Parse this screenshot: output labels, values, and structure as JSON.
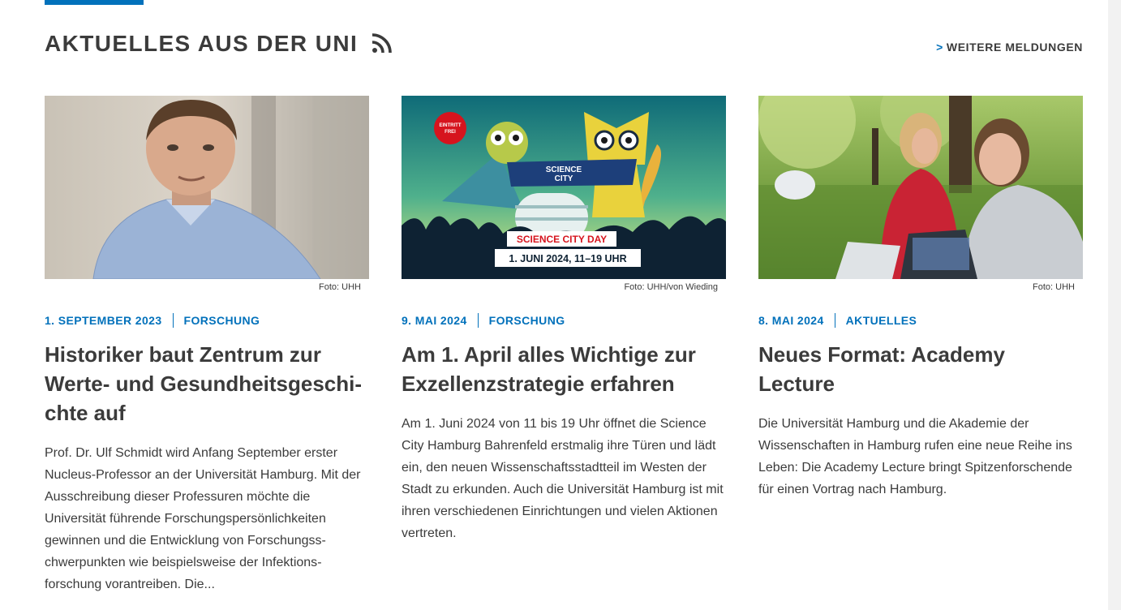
{
  "section": {
    "title": "AKTUELLES AUS DER UNI",
    "rss_icon": "rss-icon",
    "more_chevron": ">",
    "more_label": "WEITERE MELDUNGEN"
  },
  "colors": {
    "accent": "#0271bb",
    "text": "#3b3b3b"
  },
  "articles": [
    {
      "credit": "Foto: UHH",
      "date": "1. SEPTEMBER 2023",
      "category": "FORSCHUNG",
      "title": "Historiker baut Zentrum zur Werte- und Gesundheitsgeschi­chte auf",
      "teaser": "Prof. Dr. Ulf Schmidt wird Anfang September erster Nucleus-Professor an der Universität Hamburg. Mit der Ausschreibung dieser Professuren möchte die Universität führende Forschungspersönlichkeiten gewinnen und die Entwicklung von Forschungss­chwerpunkten wie beispielsweise der Infektions­forschung vorantreiben. Die..."
    },
    {
      "credit": "Foto: UHH/von Wieding",
      "date": "9. MAI 2024",
      "category": "FORSCHUNG",
      "title": "Am 1. April alles Wichtige zur Ex­zellenzstrategie erfahren",
      "teaser": "Am 1. Juni 2024 von 11 bis 19 Uhr öffnet die Science City Hamburg Bahrenfeld erstmalig ihre Türen und lädt ein, den neuen Wissenschaftsstadtteil im Wes­ten der Stadt zu erkunden. Auch die Universität Hamburg ist mit ihren verschiedenen Einrichtun­gen und vielen Aktionen vertreten.",
      "image_text": {
        "badge_line1": "EINTRITT",
        "badge_line2": "FREI",
        "banner_line1": "SCIENCE",
        "banner_line2": "CITY",
        "event_name": "SCIENCE CITY DAY",
        "event_date": "1. JUNI 2024, 11–19 UHR"
      }
    },
    {
      "credit": "Foto: UHH",
      "date": "8. MAI 2024",
      "category": "AKTUELLES",
      "title": "Neues Format: Academy Lecture",
      "teaser": "Die Universität Hamburg und die Akademie der Wissenschaften in Hamburg rufen eine neue Reihe ins Leben: Die Academy Lecture bringt Spitzenfors­chende für einen Vortrag nach Hamburg."
    }
  ]
}
